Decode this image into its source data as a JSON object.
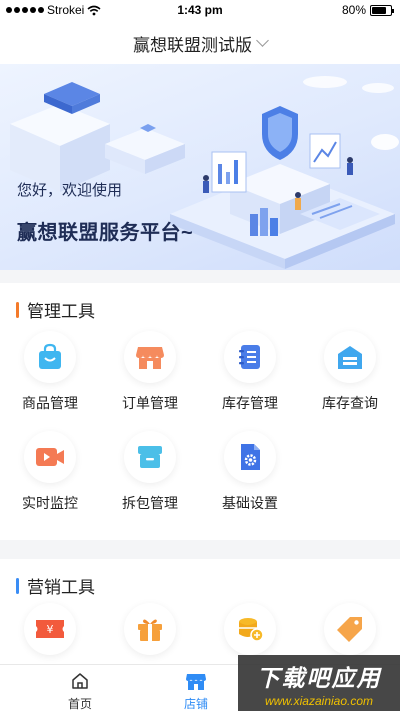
{
  "status_bar": {
    "carrier": "Strokei",
    "time": "1:43 pm",
    "battery": "80%",
    "battery_level": 0.8
  },
  "header": {
    "title": "赢想联盟测试版"
  },
  "banner": {
    "greeting": "您好，欢迎使用",
    "headline": "赢想联盟服务平台~"
  },
  "management": {
    "title": "管理工具",
    "accent": "#f47a2a",
    "items": [
      {
        "label": "商品管理",
        "icon": "bag-icon"
      },
      {
        "label": "订单管理",
        "icon": "shop-icon"
      },
      {
        "label": "库存管理",
        "icon": "notebook-icon"
      },
      {
        "label": "库存查询",
        "icon": "warehouse-icon"
      },
      {
        "label": "实时监控",
        "icon": "video-icon"
      },
      {
        "label": "拆包管理",
        "icon": "package-icon"
      },
      {
        "label": "基础设置",
        "icon": "settings-doc-icon"
      }
    ]
  },
  "marketing": {
    "title": "营销工具",
    "accent": "#3a8df5",
    "items": [
      {
        "icon": "coupon-icon"
      },
      {
        "icon": "gift-icon"
      },
      {
        "icon": "coins-icon"
      },
      {
        "icon": "tag-icon"
      }
    ]
  },
  "tabs": [
    {
      "label": "首页",
      "icon": "home-icon",
      "active": false
    },
    {
      "label": "店铺",
      "icon": "store-icon",
      "active": true
    }
  ],
  "watermark": {
    "title": "下载吧应用",
    "url": "www.xiazainiao.com"
  }
}
